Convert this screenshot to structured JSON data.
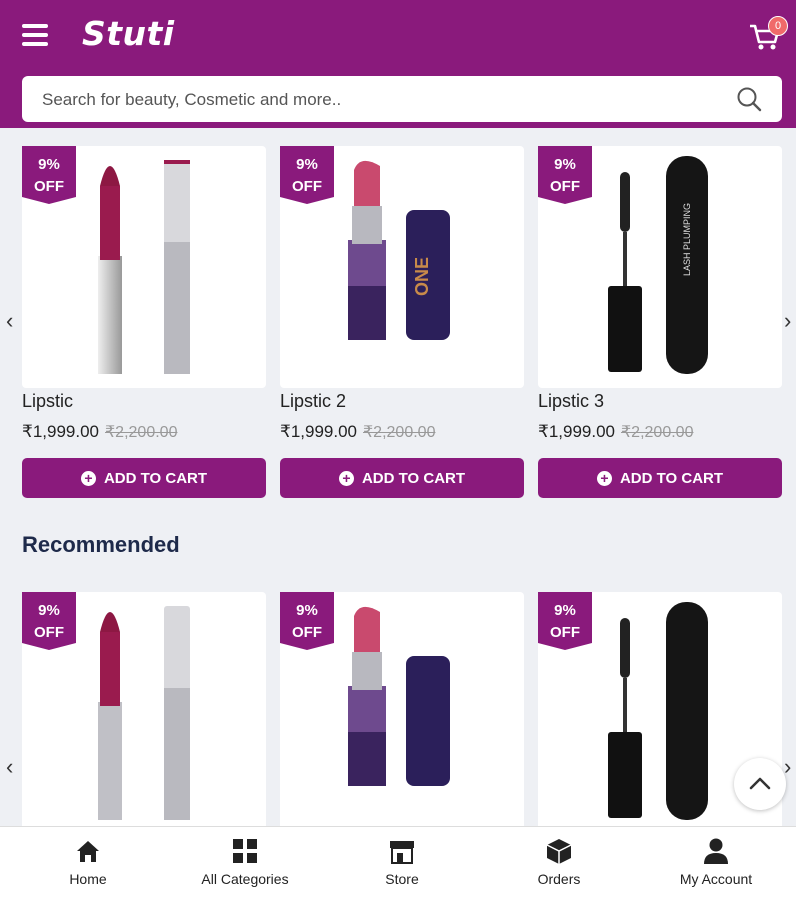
{
  "header": {
    "logo": "Stuti",
    "cart_count": "0"
  },
  "search": {
    "placeholder": "Search for beauty, Cosmetic and more.."
  },
  "top_products": [
    {
      "discount_line1": "9%",
      "discount_line2": "OFF",
      "name": "Lipstic",
      "price": "₹1,999.00",
      "old_price": "₹2,200.00",
      "button": "ADD TO CART",
      "image": "two-silver-lipsticks"
    },
    {
      "discount_line1": "9%",
      "discount_line2": "OFF",
      "name": "Lipstic 2",
      "price": "₹1,999.00",
      "old_price": "₹2,200.00",
      "button": "ADD TO CART",
      "image": "pink-lipstick-purple-cap"
    },
    {
      "discount_line1": "9%",
      "discount_line2": "OFF",
      "name": "Lipstic 3",
      "price": "₹1,999.00",
      "old_price": "₹2,200.00",
      "button": "ADD TO CART",
      "image": "mascara-wand-tube"
    }
  ],
  "recommended": {
    "title": "Recommended",
    "products": [
      {
        "discount_line1": "9%",
        "discount_line2": "OFF",
        "image": "two-silver-lipsticks"
      },
      {
        "discount_line1": "9%",
        "discount_line2": "OFF",
        "image": "pink-lipstick-purple-cap"
      },
      {
        "discount_line1": "9%",
        "discount_line2": "OFF",
        "image": "mascara-wand-tube"
      }
    ]
  },
  "bottom_nav": [
    {
      "label": "Home",
      "icon": "home-icon"
    },
    {
      "label": "All Categories",
      "icon": "grid-icon"
    },
    {
      "label": "Store",
      "icon": "store-icon"
    },
    {
      "label": "Orders",
      "icon": "box-icon"
    },
    {
      "label": "My Account",
      "icon": "user-icon"
    }
  ],
  "colors": {
    "brand": "#8a1a7c",
    "background": "#eef0f4"
  }
}
